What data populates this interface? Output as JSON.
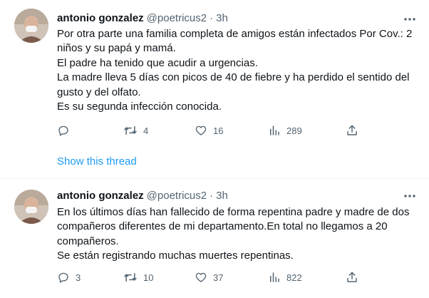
{
  "tweets": [
    {
      "author_name": "antonio gonzalez",
      "handle": "@poetricus2",
      "separator": "·",
      "time": "3h",
      "text_lines": [
        "Por otra parte una familia completa de amigos están infectados Por Cov.: 2",
        "niños y su papá y mamá.",
        "El padre ha tenido que acudir a urgencias.",
        "La madre lleva 5 días con picos de 40 de fiebre y ha perdido el sentido del",
        "gusto y del olfato.",
        "Es su segunda infección conocida."
      ],
      "stats": {
        "replies": "",
        "retweets": "4",
        "likes": "16",
        "views": "289"
      }
    },
    {
      "author_name": "antonio gonzalez",
      "handle": "@poetricus2",
      "separator": "·",
      "time": "3h",
      "text_lines": [
        "En los últimos días han fallecido de forma repentina padre y madre de dos",
        "compañeros diferentes de mi departamento.En total no llegamos a 20",
        "compañeros.",
        "Se están registrando muchas muertes repentinas."
      ],
      "stats": {
        "replies": "3",
        "retweets": "10",
        "likes": "37",
        "views": "822"
      }
    }
  ],
  "show_thread_label": "Show this thread",
  "icons": {
    "reply": "reply-icon",
    "retweet": "retweet-icon",
    "like": "like-icon",
    "views": "views-icon",
    "share": "share-icon",
    "more": "more-icon"
  },
  "colors": {
    "text": "#0f1419",
    "secondary": "#536471",
    "link": "#1d9bf0",
    "divider": "#eff3f4"
  }
}
